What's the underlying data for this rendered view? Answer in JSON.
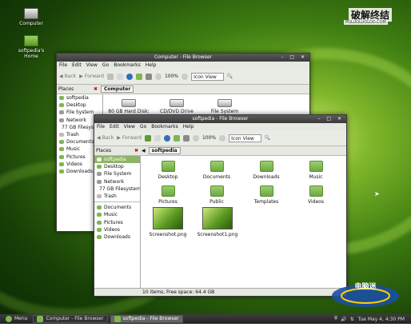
{
  "desktop": {
    "icons": [
      {
        "label": "Computer"
      },
      {
        "label": "softpedia's Home"
      }
    ],
    "watermark": "破解终结",
    "watermark_url": "POLUOLUOLOO.COM"
  },
  "colors": {
    "accent": "#8fb36a",
    "folder": "#7fb650",
    "titlebar": "#3f3f3f"
  },
  "back_window": {
    "title": "Computer - File Browser",
    "menu": [
      "File",
      "Edit",
      "View",
      "Go",
      "Bookmarks",
      "Help"
    ],
    "toolbar": {
      "back": "Back",
      "forward": "Forward",
      "zoom": "100%",
      "view": "Icon View"
    },
    "places_label": "Places",
    "location": "Computer",
    "sidebar": [
      "softpedia",
      "Desktop",
      "File System",
      "Network",
      "77 GB Filesystem",
      "Trash",
      "Documents",
      "Music",
      "Pictures",
      "Videos",
      "Downloads"
    ],
    "drives": [
      {
        "label": "80 GB Hard Disk: 77"
      },
      {
        "label": "CD/DVD Drive"
      },
      {
        "label": "File System"
      }
    ]
  },
  "front_window": {
    "title": "softpedia - File Browser",
    "menu": [
      "File",
      "Edit",
      "View",
      "Go",
      "Bookmarks",
      "Help"
    ],
    "toolbar": {
      "back": "Back",
      "forward": "Forward",
      "zoom": "100%",
      "view": "Icon View"
    },
    "places_label": "Places",
    "location": "softpedia",
    "sidebar": [
      "softpedia",
      "Desktop",
      "File System",
      "Network",
      "77 GB Filesystem",
      "Trash",
      "Documents",
      "Music",
      "Pictures",
      "Videos",
      "Downloads"
    ],
    "items": [
      {
        "label": "Desktop",
        "type": "folder"
      },
      {
        "label": "Documents",
        "type": "folder"
      },
      {
        "label": "Downloads",
        "type": "folder"
      },
      {
        "label": "Music",
        "type": "folder"
      },
      {
        "label": "Pictures",
        "type": "folder"
      },
      {
        "label": "Public",
        "type": "folder"
      },
      {
        "label": "Templates",
        "type": "folder"
      },
      {
        "label": "Videos",
        "type": "folder"
      },
      {
        "label": "Screenshot.png",
        "type": "image"
      },
      {
        "label": "Screenshot1.png",
        "type": "image"
      }
    ],
    "status": "10 items, Free space: 64.4 GB"
  },
  "taskbar": {
    "menu": "Menu",
    "tasks": [
      "Computer - File Browser",
      "softpedia - File Browser"
    ],
    "clock": "Tue May 4, 4:30 PM"
  },
  "logo_text": "电脑迷"
}
